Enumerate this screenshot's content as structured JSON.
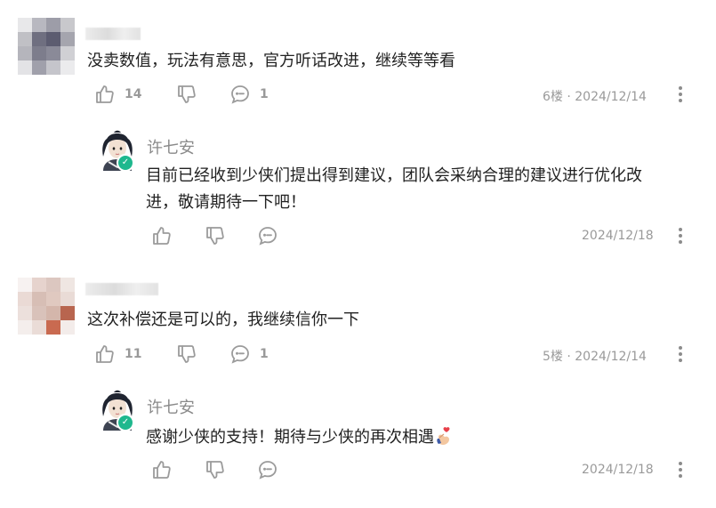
{
  "comments": [
    {
      "text": "没卖数值，玩法有意思，官方听话改进，继续等等看",
      "likes": "14",
      "replies": "1",
      "floor_date": "6楼 · 2024/12/14",
      "reply": {
        "author": "许七安",
        "lines": [
          "目前已经收到少侠们提出得到建议，团队会采纳合理的建议进行优化改",
          "进，敬请期待一下吧！"
        ],
        "date": "2024/12/18"
      }
    },
    {
      "text": "这次补偿还是可以的，我继续信你一下",
      "likes": "11",
      "replies": "1",
      "floor_date": "5楼 · 2024/12/14",
      "reply": {
        "author": "许七安",
        "lines": [
          "感谢少侠的支持！期待与少侠的再次相遇"
        ],
        "date": "2024/12/18"
      }
    }
  ],
  "icons": {
    "like": "thumbs-up-icon",
    "dislike": "thumbs-down-icon",
    "comment": "comment-bubble-icon",
    "more": "more-vertical-icon",
    "verified": "verified-check-icon",
    "emoji": "heart-hand-emoji"
  },
  "colors": {
    "icon": "#9b9b9b",
    "verified": "#1fb88e",
    "muted_text": "#9a9a9a"
  }
}
